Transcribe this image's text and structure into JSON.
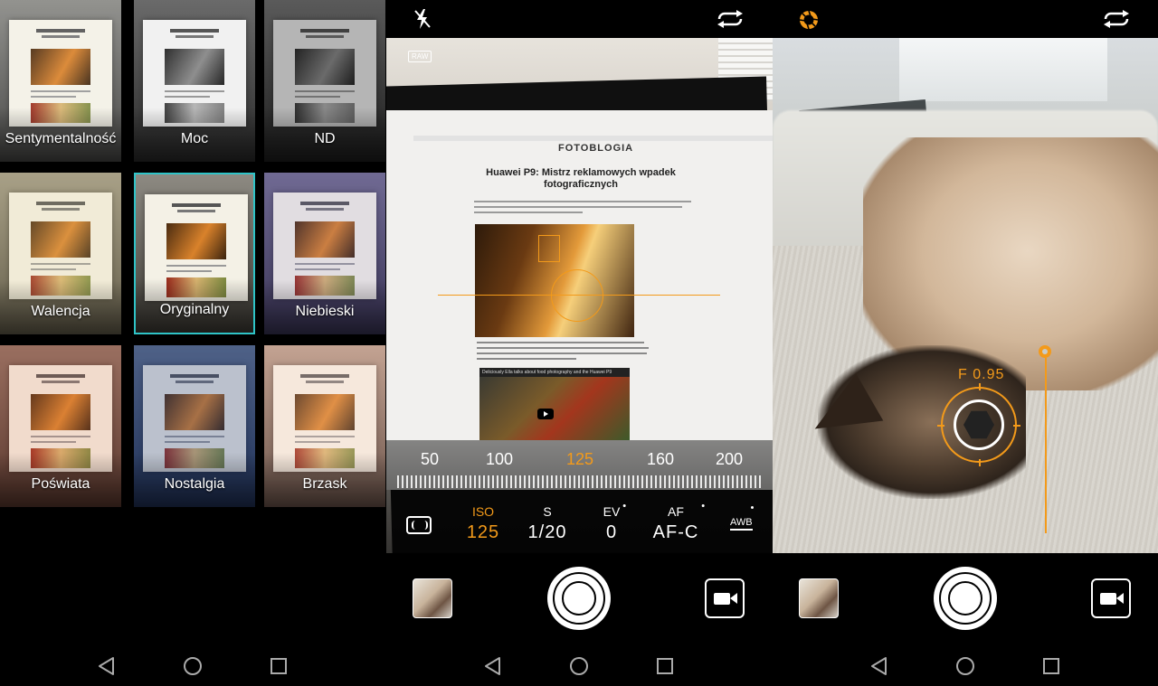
{
  "filters": {
    "items": [
      {
        "label": "Sentymentalność",
        "selected": false
      },
      {
        "label": "Moc",
        "selected": false
      },
      {
        "label": "ND",
        "selected": false
      },
      {
        "label": "Walencja",
        "selected": false
      },
      {
        "label": "Oryginalny",
        "selected": true
      },
      {
        "label": "Niebieski",
        "selected": false
      },
      {
        "label": "Poświata",
        "selected": false
      },
      {
        "label": "Nostalgia",
        "selected": false
      },
      {
        "label": "Brzask",
        "selected": false
      }
    ],
    "selected_color": "#2fc4c8"
  },
  "pro_camera": {
    "raw_badge": "RAW",
    "article": {
      "site_name": "FOTOBLOGIA",
      "title": "Huawei P9: Mistrz reklamowych wpadek fotograficznych",
      "video_title": "Deliciously Ella talks about food photography and the Huawei P9"
    },
    "iso_scale": [
      {
        "value": "50",
        "active": false
      },
      {
        "value": "100",
        "active": false
      },
      {
        "value": "125",
        "active": true
      },
      {
        "value": "160",
        "active": false
      },
      {
        "value": "200",
        "active": false
      }
    ],
    "params": [
      {
        "key": "ISO",
        "value": "125",
        "active": true
      },
      {
        "key": "S",
        "value": "1/20",
        "active": false
      },
      {
        "key": "EV",
        "value": "0",
        "active": false
      },
      {
        "key": "AF",
        "value": "AF-C",
        "active": false
      }
    ],
    "awb_label": "AWB",
    "accent_color": "#f39a1a"
  },
  "aperture_camera": {
    "f_value": "F 0.95",
    "accent_color": "#f39a1a"
  },
  "icons": {
    "flash": "flash-off-icon",
    "switch_camera": "switch-camera-icon",
    "wide_aperture": "wide-aperture-icon",
    "metering": "metering-icon",
    "gallery": "gallery-thumbnail",
    "shutter": "shutter-button",
    "video": "video-icon",
    "nav_back": "back-icon",
    "nav_home": "home-icon",
    "nav_recent": "recent-apps-icon"
  }
}
